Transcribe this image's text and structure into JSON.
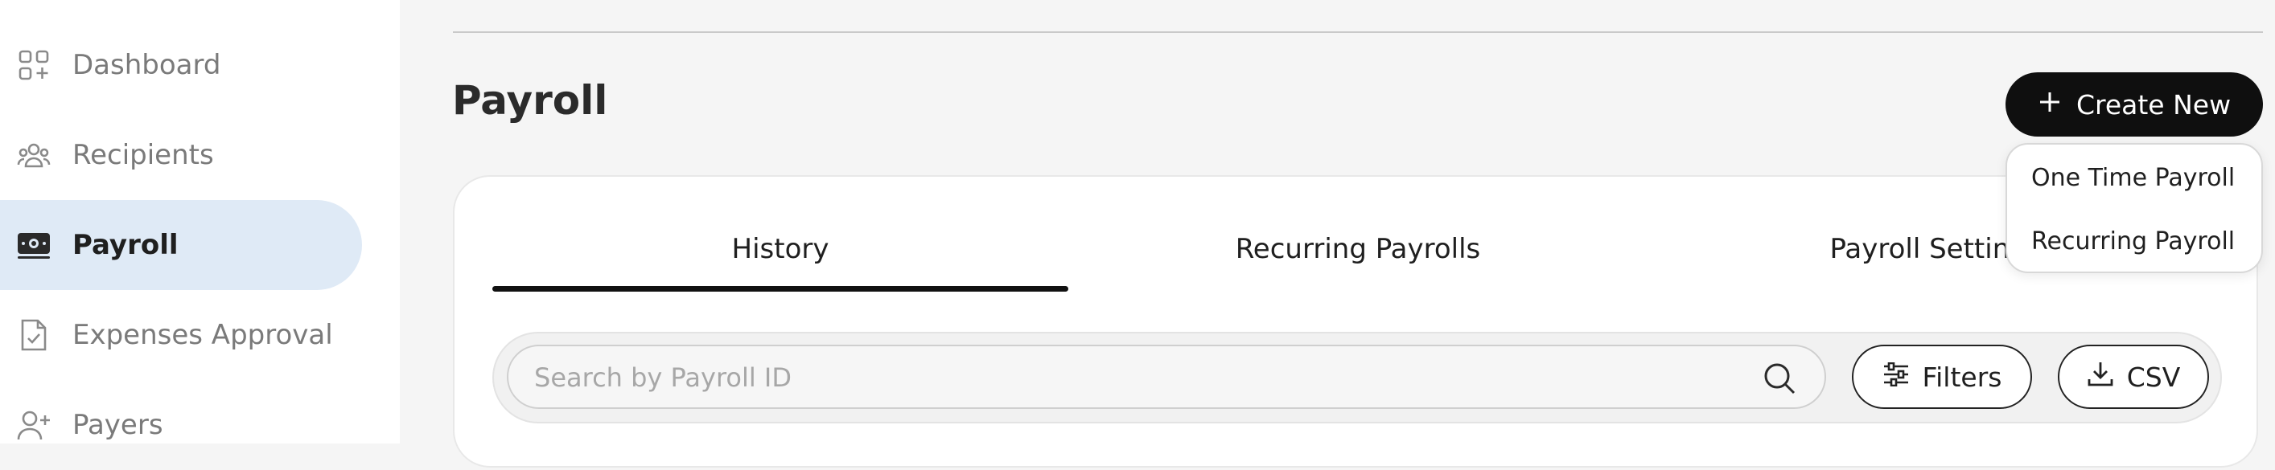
{
  "sidebar": {
    "items": [
      {
        "label": "Dashboard",
        "icon": "dashboard-icon",
        "active": false
      },
      {
        "label": "Recipients",
        "icon": "users-icon",
        "active": false
      },
      {
        "label": "Payroll",
        "icon": "payroll-icon",
        "active": true
      },
      {
        "label": "Expenses Approval",
        "icon": "document-check-icon",
        "active": false
      },
      {
        "label": "Payers",
        "icon": "user-plus-icon",
        "active": false
      }
    ]
  },
  "main": {
    "title": "Payroll",
    "create_button": {
      "label": "Create New",
      "icon": "plus-icon"
    },
    "dropdown": {
      "items": [
        "One Time Payroll",
        "Recurring Payroll"
      ]
    },
    "tabs": [
      {
        "label": "History",
        "active": true
      },
      {
        "label": "Recurring Payrolls",
        "active": false
      },
      {
        "label": "Payroll Settings",
        "active": false
      }
    ],
    "search": {
      "placeholder": "Search by Payroll ID",
      "value": ""
    },
    "filters_button": {
      "label": "Filters"
    },
    "csv_button": {
      "label": "CSV"
    }
  },
  "colors": {
    "active_nav_bg": "#dfeaf6",
    "primary_button": "#0f0f0f",
    "page_bg": "#f5f5f5"
  }
}
